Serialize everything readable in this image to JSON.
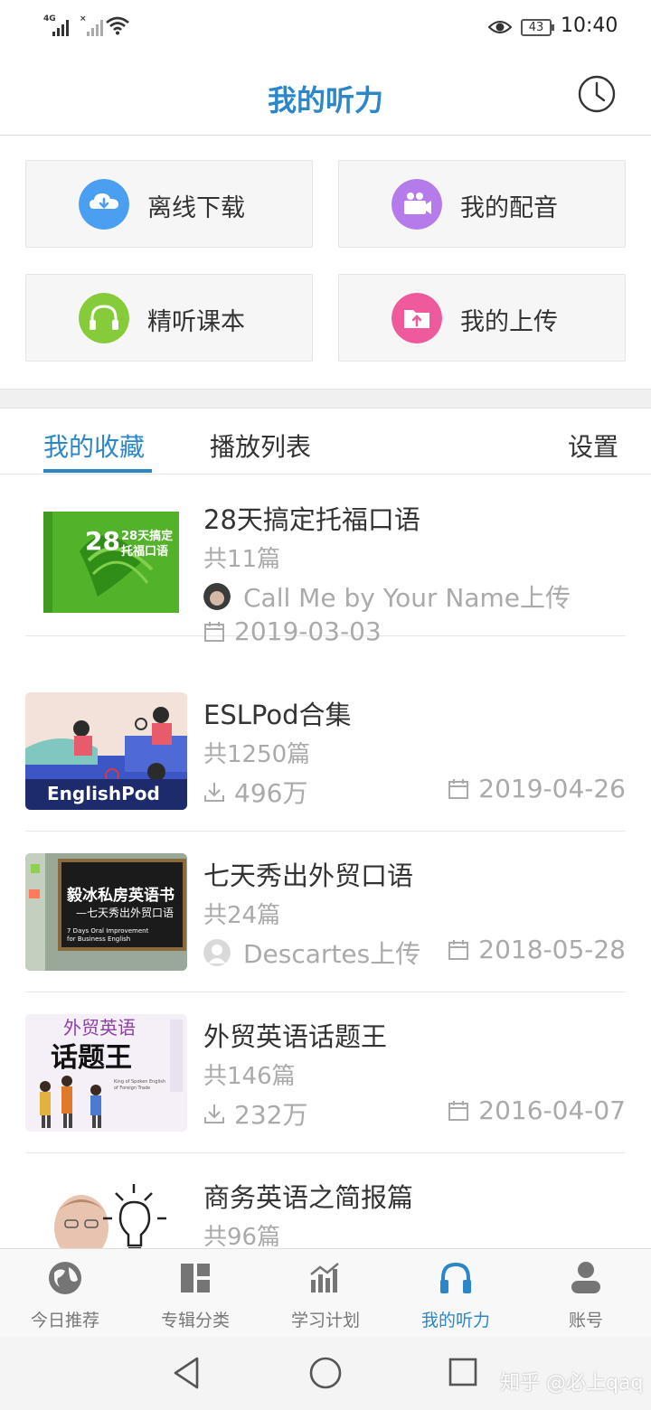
{
  "status_bar": {
    "signal1_label": "4G",
    "battery": "43",
    "time": "10:40",
    "icons": [
      "signal-icon",
      "wifi-icon",
      "eye-icon",
      "battery-icon"
    ]
  },
  "header": {
    "title": "我的听力",
    "history_icon": "clock-icon"
  },
  "quick_actions": [
    {
      "label": "离线下载",
      "icon": "cloud-download-icon",
      "color": "#4a9ff0"
    },
    {
      "label": "我的配音",
      "icon": "video-camera-icon",
      "color": "#b57bea"
    },
    {
      "label": "精听课本",
      "icon": "headphones-icon",
      "color": "#86cc3a"
    },
    {
      "label": "我的上传",
      "icon": "folder-upload-icon",
      "color": "#ee5a9c"
    }
  ],
  "tabs": {
    "favorites": "我的收藏",
    "playlist": "播放列表",
    "settings": "设置"
  },
  "items": [
    {
      "title": "28天搞定托福口语",
      "count": "共11篇",
      "uploader": "Call Me by Your Name上传",
      "date": "2019-03-03",
      "cover_title": "28天搞定",
      "cover_sub": "托福口语"
    },
    {
      "title": "ESLPod合集",
      "count": "共1250篇",
      "downloads": "496万",
      "date": "2019-04-26",
      "cover_text": "EnglishPod"
    },
    {
      "title": "七天秀出外贸口语",
      "count": "共24篇",
      "uploader": "Descartes上传",
      "date": "2018-05-28",
      "cover_line1": "毅冰私房英语书",
      "cover_line2": "—七天秀出外贸口语",
      "cover_line3": "7 Days Oral Improvement",
      "cover_line4": "for Business English"
    },
    {
      "title": "外贸英语话题王",
      "count": "共146篇",
      "downloads": "232万",
      "date": "2016-04-07",
      "cover_line1": "外贸英语",
      "cover_line2": "话题王",
      "cover_line3": "King of Spoken English",
      "cover_line4": "of Foreign Trade"
    },
    {
      "title": "商务英语之简报篇",
      "count": "共96篇"
    }
  ],
  "bottom_nav": [
    {
      "label": "今日推荐",
      "icon": "globe-icon"
    },
    {
      "label": "专辑分类",
      "icon": "grid-icon"
    },
    {
      "label": "学习计划",
      "icon": "chart-icon"
    },
    {
      "label": "我的听力",
      "icon": "headphones-icon"
    },
    {
      "label": "账号",
      "icon": "person-icon"
    }
  ],
  "colors": {
    "accent": "#2b87c8",
    "muted": "#aaaaaa"
  },
  "watermark": "知乎 @必上qaq"
}
